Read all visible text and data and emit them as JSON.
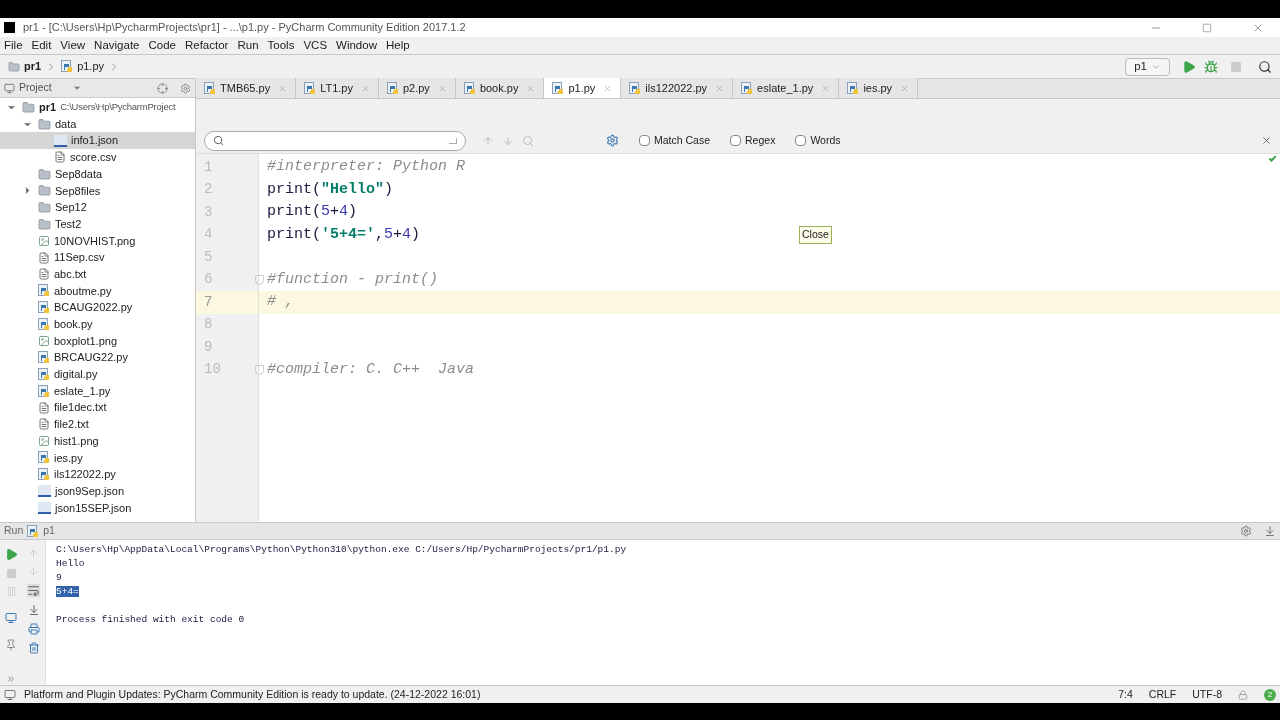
{
  "window": {
    "title": "pr1 - [C:\\Users\\Hp\\PycharmProjects\\pr1] - ...\\p1.py - PyCharm Community Edition 2017.1.2"
  },
  "menu": [
    "File",
    "Edit",
    "View",
    "Navigate",
    "Code",
    "Refactor",
    "Run",
    "Tools",
    "VCS",
    "Window",
    "Help"
  ],
  "breadcrumbs": [
    "pr1",
    "p1.py"
  ],
  "run_config": "p1",
  "sidebar": {
    "title": "Project",
    "tree": [
      {
        "name": "pr1",
        "path": "C:\\Users\\Hp\\PycharmProject",
        "kind": "folder",
        "expanded": true,
        "selected": false,
        "children": [
          {
            "name": "data",
            "kind": "folder",
            "expanded": true,
            "selected": false,
            "children": [
              {
                "name": "info1.json",
                "kind": "json",
                "selected": true
              },
              {
                "name": "score.csv",
                "kind": "text",
                "selected": false
              }
            ]
          },
          {
            "name": "Sep8data",
            "kind": "folder",
            "selected": false
          },
          {
            "name": "Sep8files",
            "kind": "folder",
            "expanded": false,
            "selected": false
          },
          {
            "name": "Sep12",
            "kind": "folder",
            "selected": false
          },
          {
            "name": "Test2",
            "kind": "folder",
            "selected": false
          },
          {
            "name": "10NOVHIST.png",
            "kind": "image",
            "selected": false
          },
          {
            "name": "11Sep.csv",
            "kind": "text",
            "selected": false
          },
          {
            "name": "abc.txt",
            "kind": "text",
            "selected": false
          },
          {
            "name": "aboutme.py",
            "kind": "python",
            "selected": false
          },
          {
            "name": "BCAUG2022.py",
            "kind": "python",
            "selected": false
          },
          {
            "name": "book.py",
            "kind": "python",
            "selected": false
          },
          {
            "name": "boxplot1.png",
            "kind": "image",
            "selected": false
          },
          {
            "name": "BRCAUG22.py",
            "kind": "python",
            "selected": false
          },
          {
            "name": "digital.py",
            "kind": "python",
            "selected": false
          },
          {
            "name": "eslate_1.py",
            "kind": "python",
            "selected": false
          },
          {
            "name": "file1dec.txt",
            "kind": "text",
            "selected": false
          },
          {
            "name": "file2.txt",
            "kind": "text",
            "selected": false
          },
          {
            "name": "hist1.png",
            "kind": "image",
            "selected": false
          },
          {
            "name": "ies.py",
            "kind": "python",
            "selected": false
          },
          {
            "name": "ils122022.py",
            "kind": "python",
            "selected": false
          },
          {
            "name": "json9Sep.json",
            "kind": "json",
            "selected": false
          },
          {
            "name": "json15SEP.json",
            "kind": "json",
            "selected": false
          }
        ]
      }
    ]
  },
  "tabs": [
    {
      "label": "TMB65.py",
      "selected": false
    },
    {
      "label": "LT1.py",
      "selected": false
    },
    {
      "label": "p2.py",
      "selected": false
    },
    {
      "label": "book.py",
      "selected": false
    },
    {
      "label": "p1.py",
      "selected": true
    },
    {
      "label": "ils122022.py",
      "selected": false
    },
    {
      "label": "eslate_1.py",
      "selected": false
    },
    {
      "label": "ies.py",
      "selected": false
    }
  ],
  "find_bar": {
    "options": [
      {
        "label": "Match Case",
        "checked": false
      },
      {
        "label": "Regex",
        "checked": false
      },
      {
        "label": "Words",
        "checked": false
      }
    ]
  },
  "tooltip": "Close",
  "code": [
    {
      "number": "1",
      "current": false,
      "fold": false,
      "tokens": [
        {
          "kind": "comment",
          "text": "#interpreter: Python R"
        }
      ]
    },
    {
      "number": "2",
      "current": false,
      "fold": false,
      "tokens": [
        {
          "kind": "plain",
          "text": "print("
        },
        {
          "kind": "string",
          "text": "\"Hello\""
        },
        {
          "kind": "plain",
          "text": ")"
        }
      ]
    },
    {
      "number": "3",
      "current": false,
      "fold": false,
      "tokens": [
        {
          "kind": "plain",
          "text": "print("
        },
        {
          "kind": "number",
          "text": "5"
        },
        {
          "kind": "plain",
          "text": "+"
        },
        {
          "kind": "number",
          "text": "4"
        },
        {
          "kind": "plain",
          "text": ")"
        }
      ]
    },
    {
      "number": "4",
      "current": false,
      "fold": false,
      "tokens": [
        {
          "kind": "plain",
          "text": "print("
        },
        {
          "kind": "string",
          "text": "'5+4='"
        },
        {
          "kind": "plain",
          "text": ","
        },
        {
          "kind": "number",
          "text": "5"
        },
        {
          "kind": "plain",
          "text": "+"
        },
        {
          "kind": "number",
          "text": "4"
        },
        {
          "kind": "plain",
          "text": ")"
        }
      ]
    },
    {
      "number": "5",
      "current": false,
      "fold": false
    },
    {
      "number": "6",
      "current": false,
      "fold": true,
      "tokens": [
        {
          "kind": "comment",
          "text": "#function - print()"
        }
      ]
    },
    {
      "number": "7",
      "current": true,
      "fold": false,
      "tokens": [
        {
          "kind": "comment",
          "text": "# ,"
        }
      ]
    },
    {
      "number": "8",
      "current": false,
      "fold": false
    },
    {
      "number": "9",
      "current": false,
      "fold": false
    },
    {
      "number": "10",
      "current": false,
      "fold": true,
      "tokens": [
        {
          "kind": "comment",
          "text": "#compiler: C. C++  Java"
        }
      ]
    }
  ],
  "run_panel": {
    "title": "Run",
    "config": "p1",
    "console": [
      {
        "kind": "command",
        "text": "C:\\Users\\Hp\\AppData\\Local\\Programs\\Python\\Python310\\python.exe C:/Users/Hp/PycharmProjects/pr1/p1.py"
      },
      {
        "kind": "output",
        "text": "Hello"
      },
      {
        "kind": "output",
        "text": "9"
      },
      {
        "kind": "selected",
        "text": "5+4="
      },
      {
        "kind": "blank"
      },
      {
        "kind": "output",
        "text": "Process finished with exit code 0"
      }
    ]
  },
  "status_bar": {
    "message": "Platform and Plugin Updates: PyCharm Community Edition is ready to update. (24-12-2022 16:01)",
    "position": "7:4",
    "line_separator": "CRLF",
    "encoding": "UTF-8",
    "notifications": "2"
  }
}
